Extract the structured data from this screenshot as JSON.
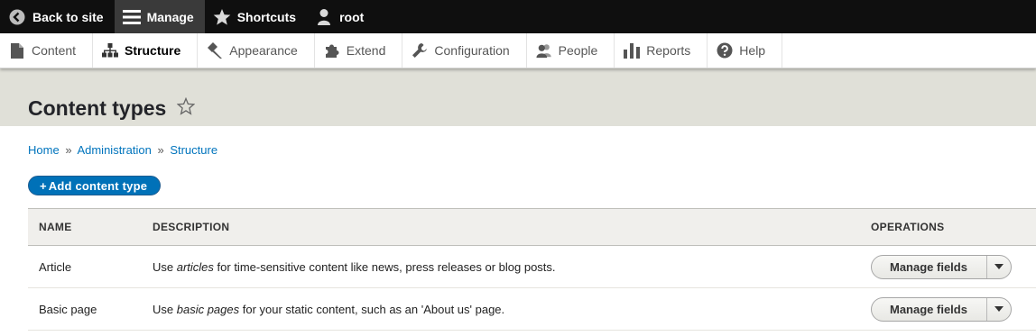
{
  "toolbar": {
    "back_label": "Back to site",
    "manage_label": "Manage",
    "shortcuts_label": "Shortcuts",
    "user_label": "root"
  },
  "tray": {
    "items": [
      {
        "label": "Content",
        "icon": "page-icon"
      },
      {
        "label": "Structure",
        "icon": "sitemap-icon"
      },
      {
        "label": "Appearance",
        "icon": "paintbrush-icon"
      },
      {
        "label": "Extend",
        "icon": "puzzle-icon"
      },
      {
        "label": "Configuration",
        "icon": "wrench-icon"
      },
      {
        "label": "People",
        "icon": "people-icon"
      },
      {
        "label": "Reports",
        "icon": "bar-chart-icon"
      },
      {
        "label": "Help",
        "icon": "help-icon"
      }
    ]
  },
  "page": {
    "title": "Content types"
  },
  "breadcrumb": {
    "items": [
      "Home",
      "Administration",
      "Structure"
    ],
    "separator": "»"
  },
  "actions": {
    "add_label": "Add content type",
    "add_prefix": "+"
  },
  "table": {
    "headers": [
      "Name",
      "Description",
      "Operations"
    ],
    "rows": [
      {
        "name": "Article",
        "desc_pre": "Use ",
        "desc_em": "articles",
        "desc_post": " for time-sensitive content like news, press releases or blog posts.",
        "operation": "Manage fields"
      },
      {
        "name": "Basic page",
        "desc_pre": "Use ",
        "desc_em": "basic pages",
        "desc_post": " for your static content, such as an 'About us' page.",
        "operation": "Manage fields"
      }
    ]
  },
  "colors": {
    "toolbar_bg": "#0f0f0f",
    "header_bg": "#e0e0d8",
    "primary": "#0071b8",
    "link": "#0074bd"
  }
}
